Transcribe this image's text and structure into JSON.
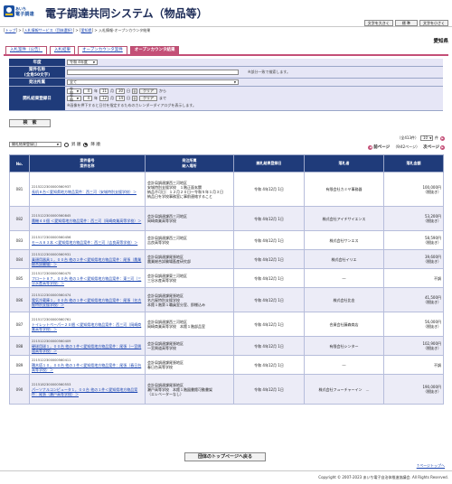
{
  "header": {
    "logo_small": "あいち",
    "logo_big": "電子調達",
    "title": "電子調達共同システム（物品等）",
    "buttons": [
      "文字を大きく",
      "標 準",
      "文字を小さく"
    ]
  },
  "breadcrumb": {
    "items": [
      "トップ",
      "入札情報サービス（団体選択）",
      "愛知県"
    ],
    "current": "入札情報-オープンカウンタ結果"
  },
  "prefecture": "愛知県",
  "tabs": [
    "入札案件（公告）",
    "入札結果",
    "オープンカウンタ案件",
    "オープンカウンタ結果"
  ],
  "form": {
    "year_label": "年度",
    "year_value": "令和 4年度",
    "case_label": "案件名称",
    "case_sub": "(全角50文字)",
    "case_note": "※部分一致で検索します。",
    "org_label": "発注所属",
    "org_value": "全て",
    "date_label": "開札結果登録日",
    "date_from": {
      "era": "令和",
      "y": "4",
      "m": "11",
      "d": "30",
      "sep": "年",
      "mon": "月",
      "day": "日"
    },
    "date_to": {
      "era": "令和",
      "y": "4",
      "m": "12",
      "d": "14"
    },
    "cal_label": "表",
    "clear_label": "クリア",
    "kara": "から",
    "made": "まで",
    "date_note": "※画像を押下すると日付を指定するためのカレンダーダイアログを表示します。"
  },
  "search_button": "検　索",
  "sort": {
    "selected": "開札結果登録日",
    "asc": "昇 順",
    "desc": "降 順"
  },
  "pager": {
    "total": "（全413件）",
    "page": "10",
    "unit": "件",
    "next_label": "次ページ",
    "prev": "前ページ",
    "pages": "（9/42ページ）",
    "next": "次ページ"
  },
  "table": {
    "headers": [
      "No.",
      "案件番号\n案件名称",
      "発注所属\n納入場所",
      "開札結果登録日",
      "落札者",
      "落札金額"
    ],
    "rows": [
      {
        "no": "081",
        "id": "2215222300000560937",
        "name": "長机８台＜愛知県地方物品案件：西三河（安城特別支援学校）＞",
        "org": "会計局調達課西三河地区\n安城特別支援学校　１階正面玄関\n納品不可日：１２月２０日～令和５年１月３日\n納品日を学校事務室に事前連絡すること",
        "date": "令和 4年12月 1日",
        "winner": "有限会社カミヤ事務器",
        "amount": "100,000円",
        "tax": "（税抜き）"
      },
      {
        "no": "082",
        "id": "2215122300000560845",
        "name": "農機４０個 ＜愛知県地方物品案件：西三河（岡崎商業高等学校）＞",
        "org": "会計局調達課西三河地区\n岡崎商業高等学校",
        "date": "令和 4年12月 1日",
        "winner": "株式会社アイチサイエンス",
        "amount": "53,200円",
        "tax": "（税抜き）"
      },
      {
        "no": "083",
        "id": "2215172300000560456",
        "name": "モール８３本 ＜愛知県地方物品案件：西三河（吉良高等学校）＞",
        "org": "会計局調達課西三河地区\n吉良高等学校",
        "date": "令和 4年12月 1日",
        "winner": "株式会社サンエス",
        "amount": "58,590円",
        "tax": "（税抜き）"
      },
      {
        "no": "084",
        "id": "2215122300000560931",
        "name": "乗顔用器具１，００台 他の２件＜愛知県地方物品案件：尾張（農業総合試験場）＞",
        "org": "会計局調達課尾張地区\n農業総合試験場畜産研究部",
        "date": "令和 4年12月 1日",
        "winner": "株式会社イリエ",
        "amount": "39,600円",
        "tax": "（税抜き）"
      },
      {
        "no": "085",
        "id": "2215172300000560475",
        "name": "フロート８７，００台 他の１件＜愛知県地方物品案件：東三河（三谷水産高等学校）＞",
        "org": "会計局調達課東三河地区\n三谷水産高等学校",
        "date": "令和 4年12月 1日",
        "winner": "―",
        "amount": "不調",
        "tax": ""
      },
      {
        "no": "086",
        "id": "2215122300000560474",
        "name": "電気冷蔵庫１，００台 他の１件＜愛知県地方物品案件：尾張（名古屋特別支援学校）＞",
        "org": "会計局調達課尾張地区\n名古屋特別支援学校\n本館１階第１職員室分室、即棚込み",
        "date": "令和 4年12月 1日",
        "winner": "株式会社比金",
        "amount": "41,500円",
        "tax": "（税抜き）"
      },
      {
        "no": "087",
        "id": "2215172300000560761",
        "name": "トイレットペーパー２０梱 ＜愛知県地方物品案件：西三河（岡崎商業高等学校）＞",
        "org": "会計局調達課西三河地区\n岡崎商業高等学校　本館１階部品室",
        "date": "令和 4年12月 1日",
        "winner": "合資会社藤森商店",
        "amount": "56,000円",
        "tax": "（税抜き）"
      },
      {
        "no": "088",
        "id": "2215122300000560409",
        "name": "硬球用球１，００台 他の１件＜愛知県地方物品案件：尾張（一宮興道高等学校）＞",
        "org": "会計局調達課尾張地区\n一宮興道高等学校",
        "date": "令和 4年12月 1日",
        "winner": "有限会社シンター",
        "amount": "102,900円",
        "tax": "（税抜き）"
      },
      {
        "no": "089",
        "id": "2215122300000560411",
        "name": "積木塔１０，００台 他の１件＜愛知県地方物品案件：尾張（春日台高等学校）＞",
        "org": "会計局調達課尾張地区\n春日台高等学校",
        "date": "令和 4年12月 1日",
        "winner": "―",
        "amount": "不調",
        "tax": ""
      },
      {
        "no": "090",
        "id": "2215182300000560553",
        "name": "パーソナルコンピュータ１，００台 他の１件＜愛知県地方物品案件：尾張（瀬戸高等学校）＞",
        "org": "会計局調達課尾張地区\n瀬戸高等学校　本館１階図書館可動書架\n（エレベーターなし）",
        "date": "令和 4年12月 1日",
        "winner": "株式会社フューチャーイン　…",
        "amount": "190,000円",
        "tax": "（税抜き）"
      }
    ]
  },
  "back_button": "団体のトップページへ戻る",
  "page_top": "↑ページトップへ",
  "copyright": "Copyright © 2007-2023 あいち電子自治体推進協議会. All Rights Reserved.",
  "colors": {
    "navy": "#1f3b7a",
    "accent": "#c44f77",
    "link": "#1a44b0",
    "band": "#ececf7"
  }
}
